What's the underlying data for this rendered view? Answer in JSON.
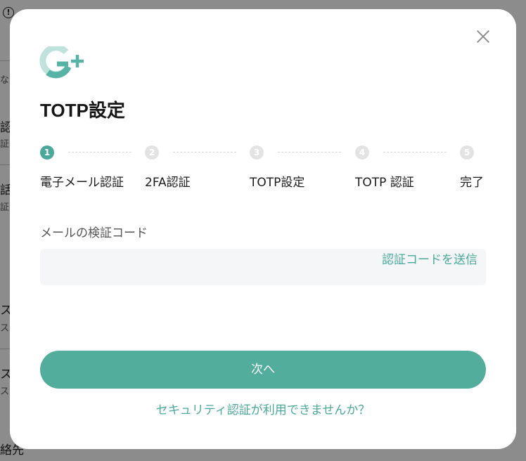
{
  "background": {
    "fragments": [
      "認",
      "証",
      "話",
      "証を",
      "ス",
      "スワ",
      "ス",
      "スワ",
      "絡先",
      "な"
    ]
  },
  "modal": {
    "title": "TOTP設定",
    "steps": [
      {
        "number": "1",
        "label": "電子メール認証",
        "active": true
      },
      {
        "number": "2",
        "label": "2FA認証",
        "active": false
      },
      {
        "number": "3",
        "label": "TOTP設定",
        "active": false
      },
      {
        "number": "4",
        "label": "TOTP 認証",
        "active": false
      },
      {
        "number": "5",
        "label": "完了",
        "active": false
      }
    ],
    "email_code": {
      "label": "メールの検証コード",
      "value": "",
      "send_label": "認証コードを送信"
    },
    "next_label": "次へ",
    "help_link": "セキュリティ認証が利用できませんか？"
  },
  "colors": {
    "accent": "#52ad9c",
    "inactive_step": "#e3e3e3",
    "field_bg": "#f4f6f8"
  }
}
